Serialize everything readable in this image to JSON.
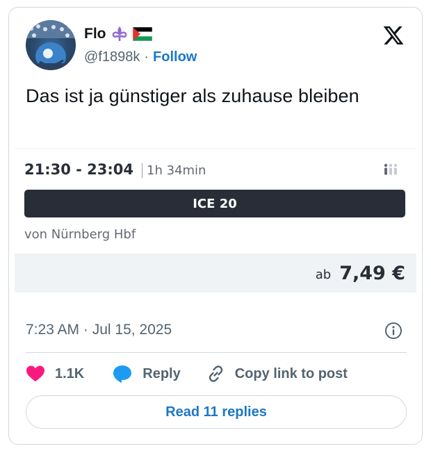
{
  "author": {
    "name": "Flo",
    "handle": "@f1898k",
    "separator": "·",
    "follow_label": "Follow",
    "name_emojis": [
      "fleur-de-lis-icon",
      "palestine-flag-icon"
    ]
  },
  "tweet": {
    "text": "Das ist ja günstiger als zuhause bleiben"
  },
  "ticket": {
    "times": "21:30 - 23:04",
    "duration": "1h 34min",
    "train": "ICE 20",
    "from": "von Nürnberg Hbf",
    "price_prefix": "ab",
    "price": "7,49 €"
  },
  "meta": {
    "timestamp": "7:23 AM · Jul 15, 2025"
  },
  "actions": {
    "likes": "1.1K",
    "reply": "Reply",
    "copy_link": "Copy link to post",
    "read_replies": "Read 11 replies"
  },
  "colors": {
    "accent": "#1d77c5",
    "like": "#f91880",
    "reply_bubble": "#1d9bf0",
    "train_bar": "#282d37",
    "price_band": "#f0f3f5"
  }
}
